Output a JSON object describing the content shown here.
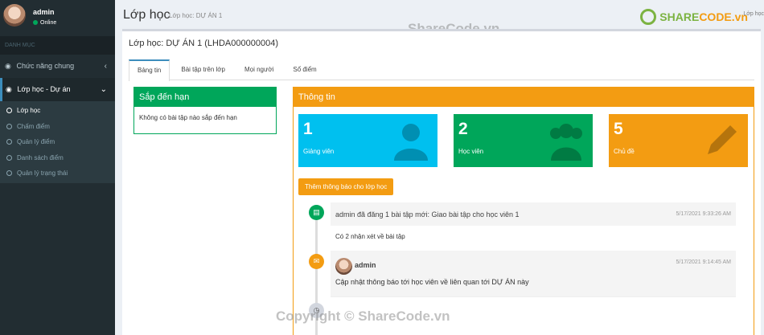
{
  "sidebar": {
    "user_name": "admin",
    "user_status": "Online",
    "menu_header": "DANH MỤC",
    "items": [
      {
        "label": "Chức năng chung",
        "icon": "dashboard-icon"
      },
      {
        "label": "Lớp học - Dự án",
        "icon": "dashboard-icon"
      }
    ],
    "subitems": [
      "Lớp học",
      "Chấm điểm",
      "Quản lý điểm",
      "Danh sách điểm",
      "Quản lý trạng thái"
    ]
  },
  "header": {
    "title": "Lớp học",
    "subtitle": "Lớp học: DỰ ÁN 1",
    "logo_share": "SHARE",
    "logo_code": "CODE.vn",
    "corner": "Lớp học"
  },
  "watermark": "ShareCode.vn",
  "copyright": "Copyright © ShareCode.vn",
  "main": {
    "title": "Lớp học: DỰ ÁN 1 (LHDA000000004)",
    "tabs": [
      "Bảng tin",
      "Bài tập trên lớp",
      "Mọi người",
      "Sổ điểm"
    ],
    "due": {
      "title": "Sắp đến hạn",
      "empty": "Không có bài tập nào sắp đến hạn"
    },
    "info": {
      "title": "Thông tin",
      "stats": [
        {
          "num": "1",
          "label": "Giảng viên"
        },
        {
          "num": "2",
          "label": "Học viên"
        },
        {
          "num": "5",
          "label": "Chủ đề"
        }
      ],
      "add_button": "Thêm thông báo cho lớp học"
    },
    "timeline": [
      {
        "header": "admin đã đăng 1 bài tập mới: Giao bài tập cho học viên 1",
        "time": "5/17/2021 9:33:26 AM",
        "body": "Có 2 nhận xét về bài tập"
      },
      {
        "author": "admin",
        "time": "5/17/2021 9:14:45 AM",
        "body": "Cập nhật thông báo tới học viên về liên quan tới DỰ ÁN này"
      }
    ]
  },
  "colors": {
    "aqua": "#00c0ef",
    "green": "#00a65a",
    "yellow": "#f39c12",
    "sidebar": "#222d32"
  }
}
